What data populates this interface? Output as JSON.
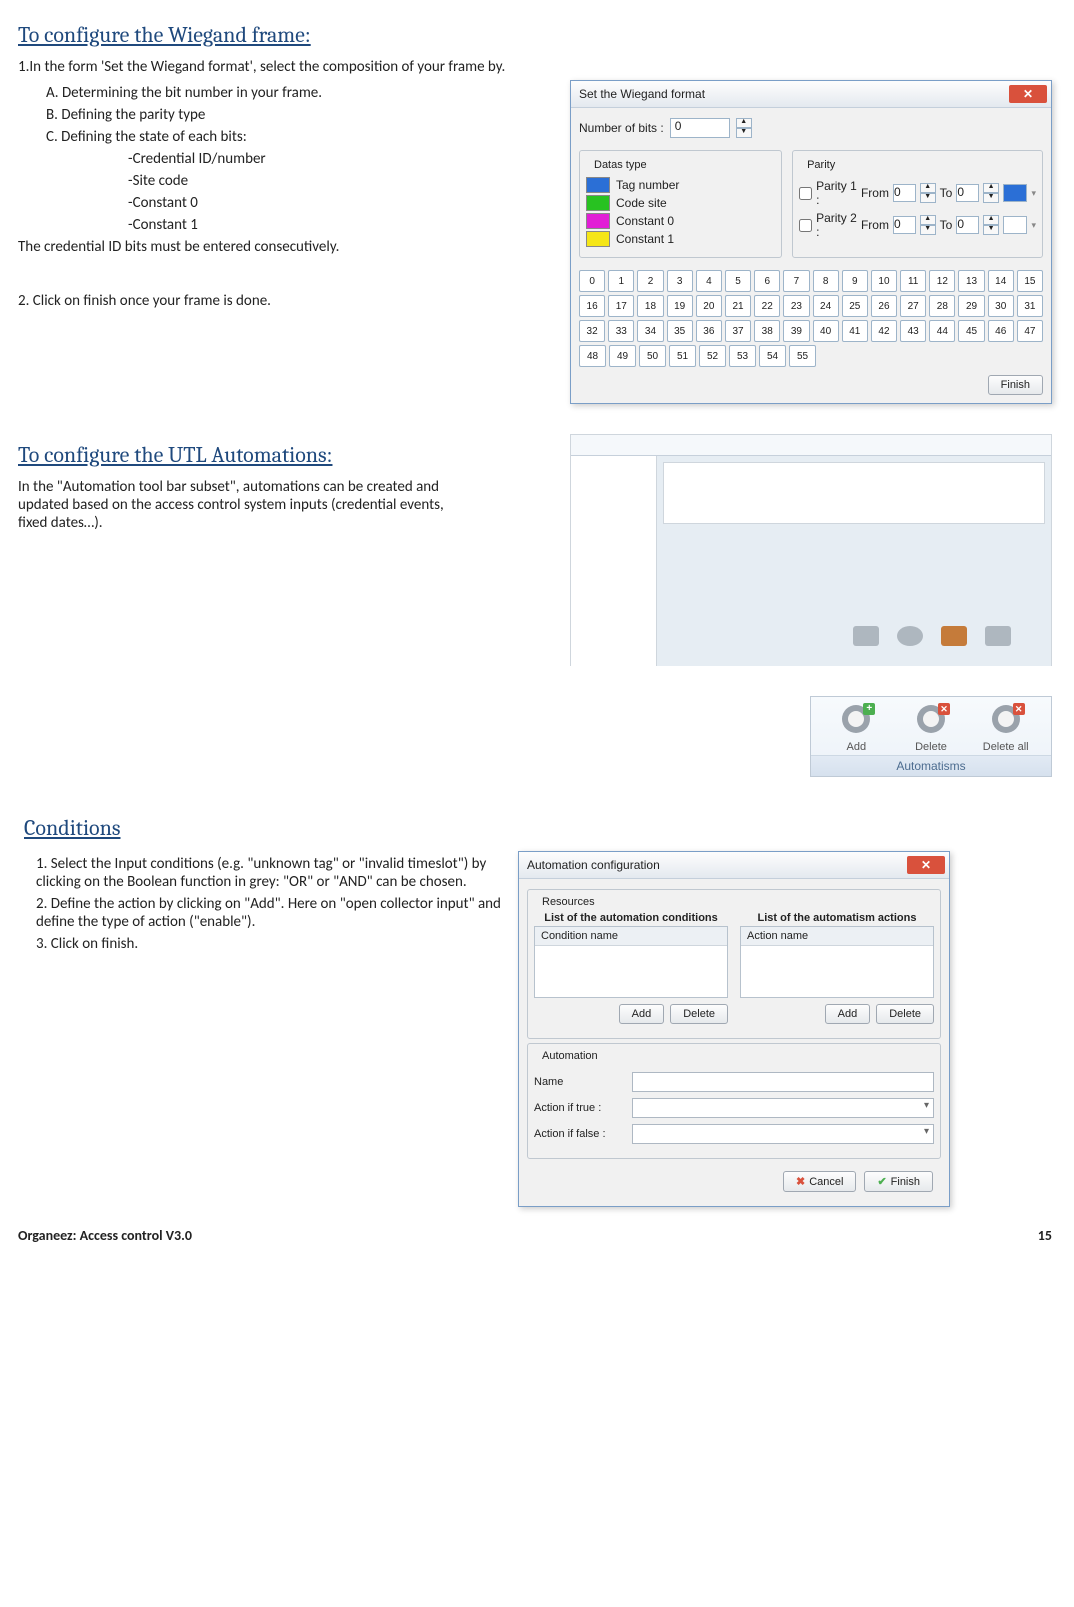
{
  "section1": {
    "heading": "To configure the Wiegand frame:",
    "intro": "1.In the form 'Set the Wiegand format', select the composition of your frame by.",
    "items": {
      "a": "A.    Determining the bit number in your frame.",
      "b": "B.    Defining the parity type",
      "c": "C.    Defining the  state of each bits:",
      "c1": "-Credential ID/number",
      "c2": "-Site code",
      "c3": "-Constant 0",
      "c4": "-Constant 1"
    },
    "note": "The credential ID bits must be entered consecutively.",
    "step2": "2. Click on finish once your frame is done."
  },
  "wiegand_dialog": {
    "title": "Set the Wiegand format",
    "num_bits_label": "Number of bits :",
    "num_bits_value": "0",
    "datas_type_label": "Datas type",
    "parity_label": "Parity",
    "types": [
      {
        "label": "Tag number",
        "color": "#2b6fd6"
      },
      {
        "label": "Code site",
        "color": "#28c221"
      },
      {
        "label": "Constant 0",
        "color": "#e21ed6"
      },
      {
        "label": "Constant 1",
        "color": "#f5e617"
      }
    ],
    "parity1_label": "Parity 1 :",
    "parity2_label": "Parity 2 :",
    "from_label": "From",
    "to_label": "To",
    "zero": "0",
    "parity1_color": "#2b6fd6",
    "bits_rows": [
      [
        0,
        1,
        2,
        3,
        4,
        5,
        6,
        7,
        8,
        9,
        10,
        11,
        12,
        13,
        14,
        15
      ],
      [
        16,
        17,
        18,
        19,
        20,
        21,
        22,
        23,
        24,
        25,
        26,
        27,
        28,
        29,
        30,
        31
      ],
      [
        32,
        33,
        34,
        35,
        36,
        37,
        38,
        39,
        40,
        41,
        42,
        43,
        44,
        45,
        46,
        47
      ],
      [
        48,
        49,
        50,
        51,
        52,
        53,
        54,
        55
      ]
    ],
    "finish": "Finish"
  },
  "section2": {
    "heading": "To configure the UTL Automations:",
    "para": "In the \"Automation tool bar subset\", automations can be created and updated based on the access control system inputs (credential events, fixed dates…)."
  },
  "ribbon": {
    "add": "Add",
    "delete": "Delete",
    "delete_all": "Delete all",
    "group_title": "Automatisms"
  },
  "section3": {
    "heading": "Conditions",
    "s1": "1. Select the Input conditions (e.g.  \"unknown tag\" or \"invalid timeslot\") by clicking on the Boolean function in grey: \"OR\" or  \"AND\" can be chosen.",
    "s2": "2. Define the action by clicking on \"Add\". Here on \"open collector input\" and define the type of action (\"enable\").",
    "s3": "3. Click on finish."
  },
  "cfg_dialog": {
    "title": "Automation configuration",
    "resources": "Resources",
    "conditions_title": "List of the automation conditions",
    "actions_title": "List of the automatism actions",
    "condition_col": "Condition name",
    "action_col": "Action name",
    "add": "Add",
    "delete": "Delete",
    "automation_group": "Automation",
    "name_label": "Name",
    "true_label": "Action if true :",
    "false_label": "Action if false :",
    "cancel": "Cancel",
    "finish": "Finish"
  },
  "footer": {
    "left": "Organeez: Access control     V3.0",
    "right": "15"
  }
}
